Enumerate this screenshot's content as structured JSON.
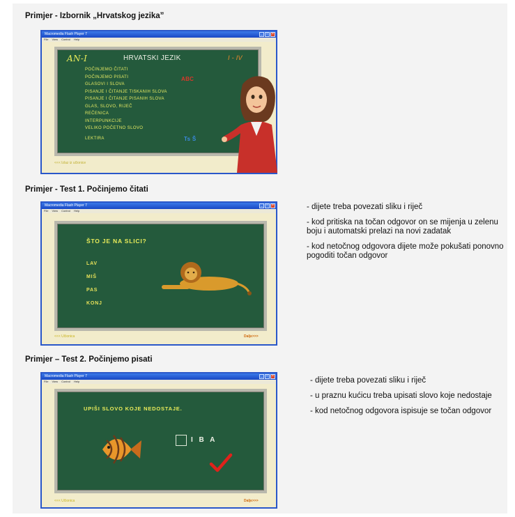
{
  "sections": [
    {
      "heading": "Primjer - Izbornik „Hrvatskog jezika”",
      "window_title": "Macromedia Flash Player 7",
      "menu": [
        "File",
        "View",
        "Control",
        "Help"
      ],
      "board": {
        "left_label": "AN-I",
        "title": "HRVATSKI JEZIK",
        "right_label": "I - IV",
        "items": [
          "POČINJEMO ČITATI",
          "POČINJEMO PISATI",
          "GLASOVI I SLOVA",
          "PISANJE I ČITANJE TISKANIH SLOVA",
          "PISANJE I ČITANJE PISANIH SLOVA",
          "GLAS, SLOVO, RIJEČ",
          "REČENICA",
          "INTERPUNKCIJE",
          "VELIKO POČETNO SLOVO",
          "LEKTIRA"
        ],
        "red_mark": "ABC",
        "blue_mark": "Ts Š",
        "bottom_link": "<<< Izlaz iz učionice"
      }
    },
    {
      "heading": "Primjer - Test 1. Počinjemo čitati",
      "window_title": "Macromedia Flash Player 7",
      "menu": [
        "File",
        "View",
        "Control",
        "Help"
      ],
      "board": {
        "question": "ŠTO JE NA SLICI?",
        "answers": [
          "LAV",
          "MIŠ",
          "PAS",
          "KONJ"
        ],
        "back_link": "<<< Učionica",
        "next_link": "Dalje>>>"
      },
      "description": [
        "- dijete treba povezati sliku i riječ",
        "- kod pritiska na točan odgovor on se mijenja u zelenu boju i automatski prelazi na novi zadatak",
        "- kod netočnog odgovora dijete može pokušati ponovno pogoditi točan odgovor"
      ]
    },
    {
      "heading": "Primjer – Test 2. Počinjemo pisati",
      "window_title": "Macromedia Flash Player 7",
      "menu": [
        "File",
        "View",
        "Control",
        "Help"
      ],
      "board": {
        "question": "UPIŠI SLOVO KOJE NEDOSTAJE.",
        "letters": "I B A",
        "back_link": "<<< Učionica",
        "next_link": "Dalje>>>"
      },
      "description": [
        "- dijete treba povezati sliku i riječ",
        "- u praznu kućicu treba upisati slovo koje nedostaje",
        "- kod netočnog odgovora ispisuje se točan odgovor"
      ]
    }
  ],
  "colors": {
    "board": "#245a3c",
    "chalk_yellow": "#e9ec5a",
    "window_frame": "#2a57c9",
    "check": "#e0221b"
  }
}
